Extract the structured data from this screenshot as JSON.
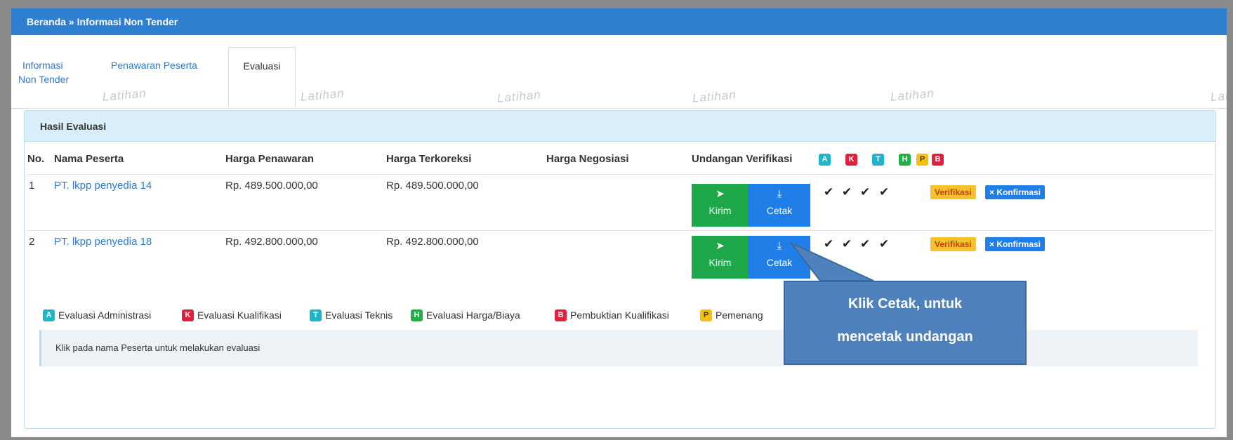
{
  "breadcrumb": "Beranda » Informasi Non Tender",
  "tabs": [
    {
      "label_line1": "Informasi",
      "label_line2": "Non Tender"
    },
    {
      "label": "Penawaran Peserta"
    },
    {
      "label": "Evaluasi"
    }
  ],
  "watermark": "Latihan",
  "panel": {
    "title": "Hasil Evaluasi",
    "columns": {
      "no": "No.",
      "nama": "Nama Peserta",
      "penawaran": "Harga Penawaran",
      "terkoreksi": "Harga Terkoreksi",
      "negosiasi": "Harga Negosiasi",
      "undangan": "Undangan Verifikasi"
    },
    "badges": [
      "A",
      "K",
      "T",
      "H",
      "P",
      "B"
    ],
    "rows": [
      {
        "no": "1",
        "nama": "PT. lkpp penyedia 14",
        "penawaran": "Rp. 489.500.000,00",
        "terkoreksi": "Rp. 489.500.000,00",
        "negosiasi": ""
      },
      {
        "no": "2",
        "nama": "PT. lkpp penyedia 18",
        "penawaran": "Rp. 492.800.000,00",
        "terkoreksi": "Rp. 492.800.000,00",
        "negosiasi": ""
      }
    ],
    "kirim_label": "Kirim",
    "cetak_label": "Cetak",
    "check_mark": "✔",
    "verifikasi_label": "Verifikasi",
    "konfirmasi_label": "× Konfirmasi",
    "legend": [
      {
        "badge": "A",
        "label": "Evaluasi Administrasi"
      },
      {
        "badge": "K",
        "label": "Evaluasi Kualifikasi"
      },
      {
        "badge": "T",
        "label": "Evaluasi Teknis"
      },
      {
        "badge": "H",
        "label": "Evaluasi Harga/Biaya"
      },
      {
        "badge": "B",
        "label": "Pembuktian Kualifikasi"
      },
      {
        "badge": "P",
        "label": "Pemenang"
      }
    ],
    "note": "Klik pada nama Peserta untuk melakukan evaluasi"
  },
  "callout": {
    "line1": "Klik Cetak, untuk",
    "line2": "mencetak undangan"
  },
  "colors": {
    "header": "#2f7fd0",
    "kirim": "#1fa84a",
    "cetak": "#1f7ee8",
    "callout": "#4f81bd"
  },
  "icons": {
    "kirim": "paper-plane-icon",
    "cetak": "download-icon"
  }
}
